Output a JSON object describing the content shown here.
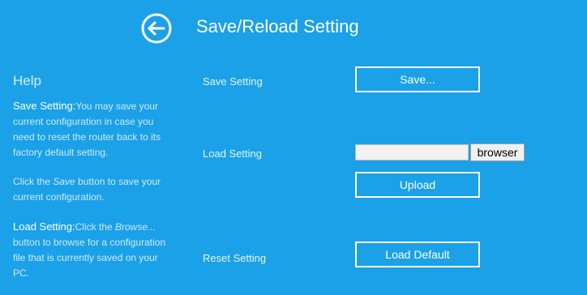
{
  "header": {
    "title": "Save/Reload Setting",
    "back_icon": "arrow-left-circle-icon"
  },
  "help": {
    "title": "Help",
    "save_heading": "Save Setting:",
    "save_text": "You may save your current configuration in case you need to reset the router back to its factory default setting.",
    "click_prefix": "Click the ",
    "click_save_word": "Save",
    "click_suffix": " button to save your current configuration.",
    "load_heading": "Load Setting:",
    "load_text_prefix": "Click the ",
    "load_browse_word": "Browse...",
    "load_text_suffix": " button to browse for a configuration file that is currently saved on your PC."
  },
  "rows": {
    "save_label": "Save Setting",
    "save_button": "Save...",
    "load_label": "Load Setting",
    "file_value": "",
    "browse_button": "browser",
    "upload_button": "Upload",
    "reset_label": "Reset Setting",
    "load_default_button": "Load Default"
  },
  "colors": {
    "background": "#1aa1e8",
    "text": "#ffffff"
  }
}
